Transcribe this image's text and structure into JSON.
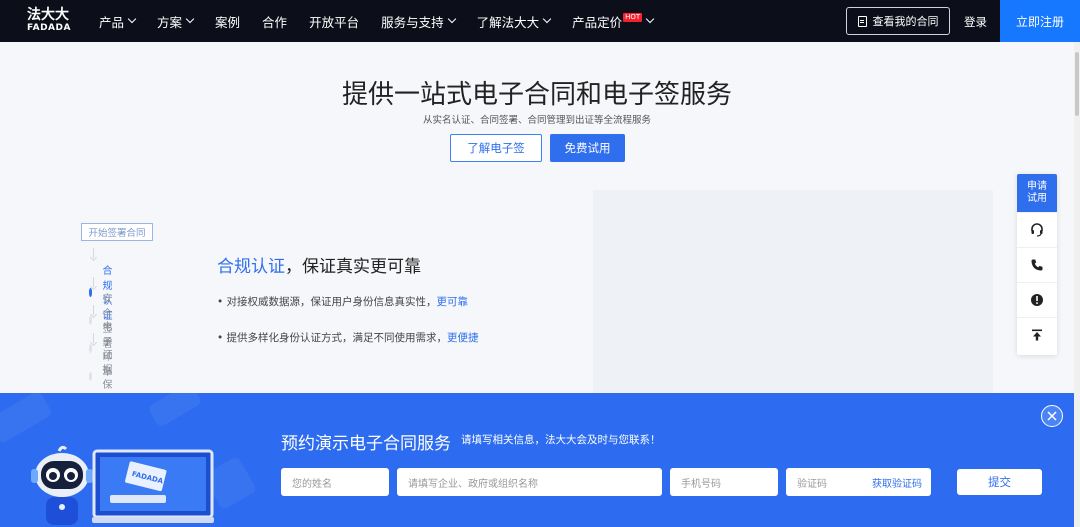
{
  "nav": {
    "logo_line1": "法大大",
    "logo_line2": "FADADA",
    "items": [
      {
        "label": "产品",
        "dropdown": true
      },
      {
        "label": "方案",
        "dropdown": true
      },
      {
        "label": "案例",
        "dropdown": false
      },
      {
        "label": "合作",
        "dropdown": false
      },
      {
        "label": "开放平台",
        "dropdown": false
      },
      {
        "label": "服务与支持",
        "dropdown": true
      },
      {
        "label": "了解法大大",
        "dropdown": true
      },
      {
        "label": "产品定价",
        "dropdown": true,
        "badge": "HOT"
      }
    ],
    "contract_button": "查看我的合同",
    "login": "登录",
    "register": "立即注册"
  },
  "hero": {
    "title": "提供一站式电子合同和电子签服务",
    "subtitle": "从实名认证、合同签署、合同管理到出证等全流程服务",
    "learn_button": "了解电子签",
    "trial_button": "免费试用"
  },
  "steps": {
    "start_label": "开始签署合同",
    "items": [
      "合规认证",
      "安全签署",
      "电子印章",
      "证据保存"
    ],
    "active_index": 0
  },
  "feature": {
    "title_highlight": "合规认证",
    "title_rest": "，保证真实更可靠",
    "points": [
      {
        "text": "• 对接权威数据源，保证用户身份信息真实性，",
        "link": "更可靠"
      },
      {
        "text": "• 提供多样化身份认证方式，满足不同使用需求，",
        "link": "更便捷"
      }
    ]
  },
  "side_widget": {
    "trial_label": "申请\n试用",
    "icons": [
      "headset-icon",
      "phone-icon",
      "alert-icon",
      "back-to-top-icon"
    ]
  },
  "banner": {
    "title": "预约演示电子合同服务",
    "subtitle": "请填写相关信息，法大大会及时与您联系！",
    "name_placeholder": "您的姓名",
    "org_placeholder": "请填写企业、政府或组织名称",
    "phone_placeholder": "手机号码",
    "code_placeholder": "验证码",
    "get_code": "获取验证码",
    "submit": "提交",
    "mascot_screen_text": "FADADA"
  },
  "colors": {
    "nav_bg": "#0c0f1a",
    "primary": "#2f6fed",
    "register_bg": "#1677ff",
    "banner_bg": "#2d6cf0"
  }
}
